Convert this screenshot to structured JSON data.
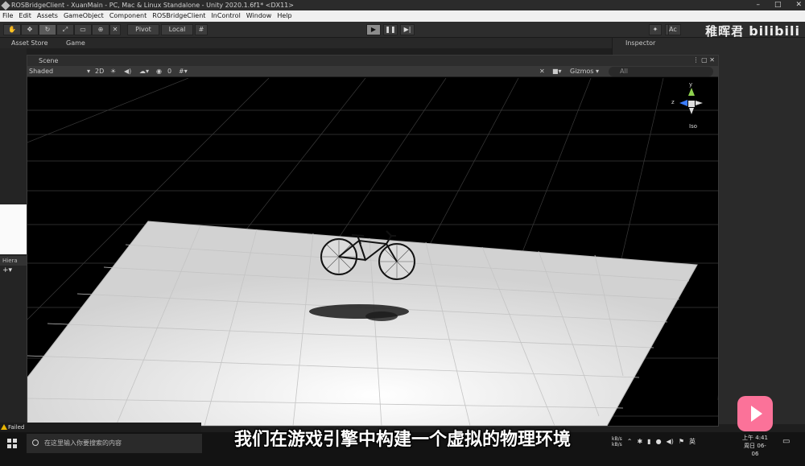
{
  "window": {
    "title": "ROSBridgeClient - XuanMain - PC, Mac & Linux Standalone - Unity 2020.1.6f1* <DX11>"
  },
  "menu": [
    "File",
    "Edit",
    "Assets",
    "GameObject",
    "Component",
    "ROSBridgeClient",
    "InControl",
    "Window",
    "Help"
  ],
  "toolbar": {
    "pivot_label": "Pivot",
    "local_label": "Local",
    "account_label": "Ac"
  },
  "watermark": {
    "author": "稚晖君",
    "brand": "bilibili"
  },
  "tabs": {
    "asset_store": "Asset Store",
    "game": "Game",
    "inspector": "Inspector"
  },
  "scene": {
    "tab_label": "Scene",
    "shading_mode": "Shaded",
    "mode_2d": "2D",
    "hidden_count": "0",
    "gizmos_label": "Gizmos",
    "search_placeholder": "All",
    "gizmo_axis_y": "y",
    "gizmo_axis_z": "z",
    "projection_label": "Iso"
  },
  "hierarchy": {
    "tab_label": "Hiera"
  },
  "status": {
    "message": "Failed"
  },
  "taskbar": {
    "search_placeholder": "在这里输入你要搜索的内容",
    "net_up": "kB/s",
    "net_down": "kB/s",
    "ime": "英",
    "time": "上午 4:41",
    "date": "周日 06-06"
  },
  "subtitle": "我们在游戏引擎中构建一个虚拟的物理环境",
  "colors": {
    "accent_badge": "#fb7299",
    "viewport_bg": "#000000",
    "ground_plane": "#e6e6e6"
  }
}
